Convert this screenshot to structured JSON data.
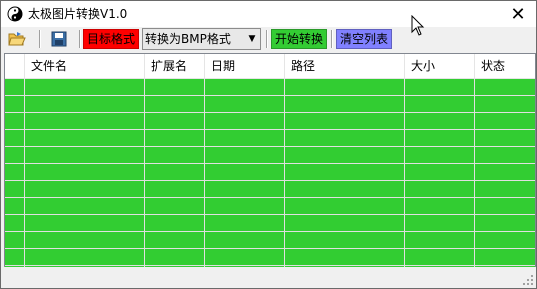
{
  "window": {
    "title": "太极图片转换V1.0"
  },
  "toolbar": {
    "open_icon": "open-folder-icon",
    "save_icon": "save-disk-icon",
    "target_format_label": "目标格式",
    "format_selected": "转换为BMP格式",
    "start_button": "开始转换",
    "clear_button": "清空列表",
    "colors": {
      "target_label_bg": "#ff0000",
      "start_bg": "#33cc33",
      "clear_bg": "#8080ff"
    }
  },
  "list": {
    "columns": [
      "",
      "文件名",
      "扩展名",
      "日期",
      "路径",
      "大小",
      "状态"
    ],
    "background": "#32cd32",
    "rows": []
  }
}
